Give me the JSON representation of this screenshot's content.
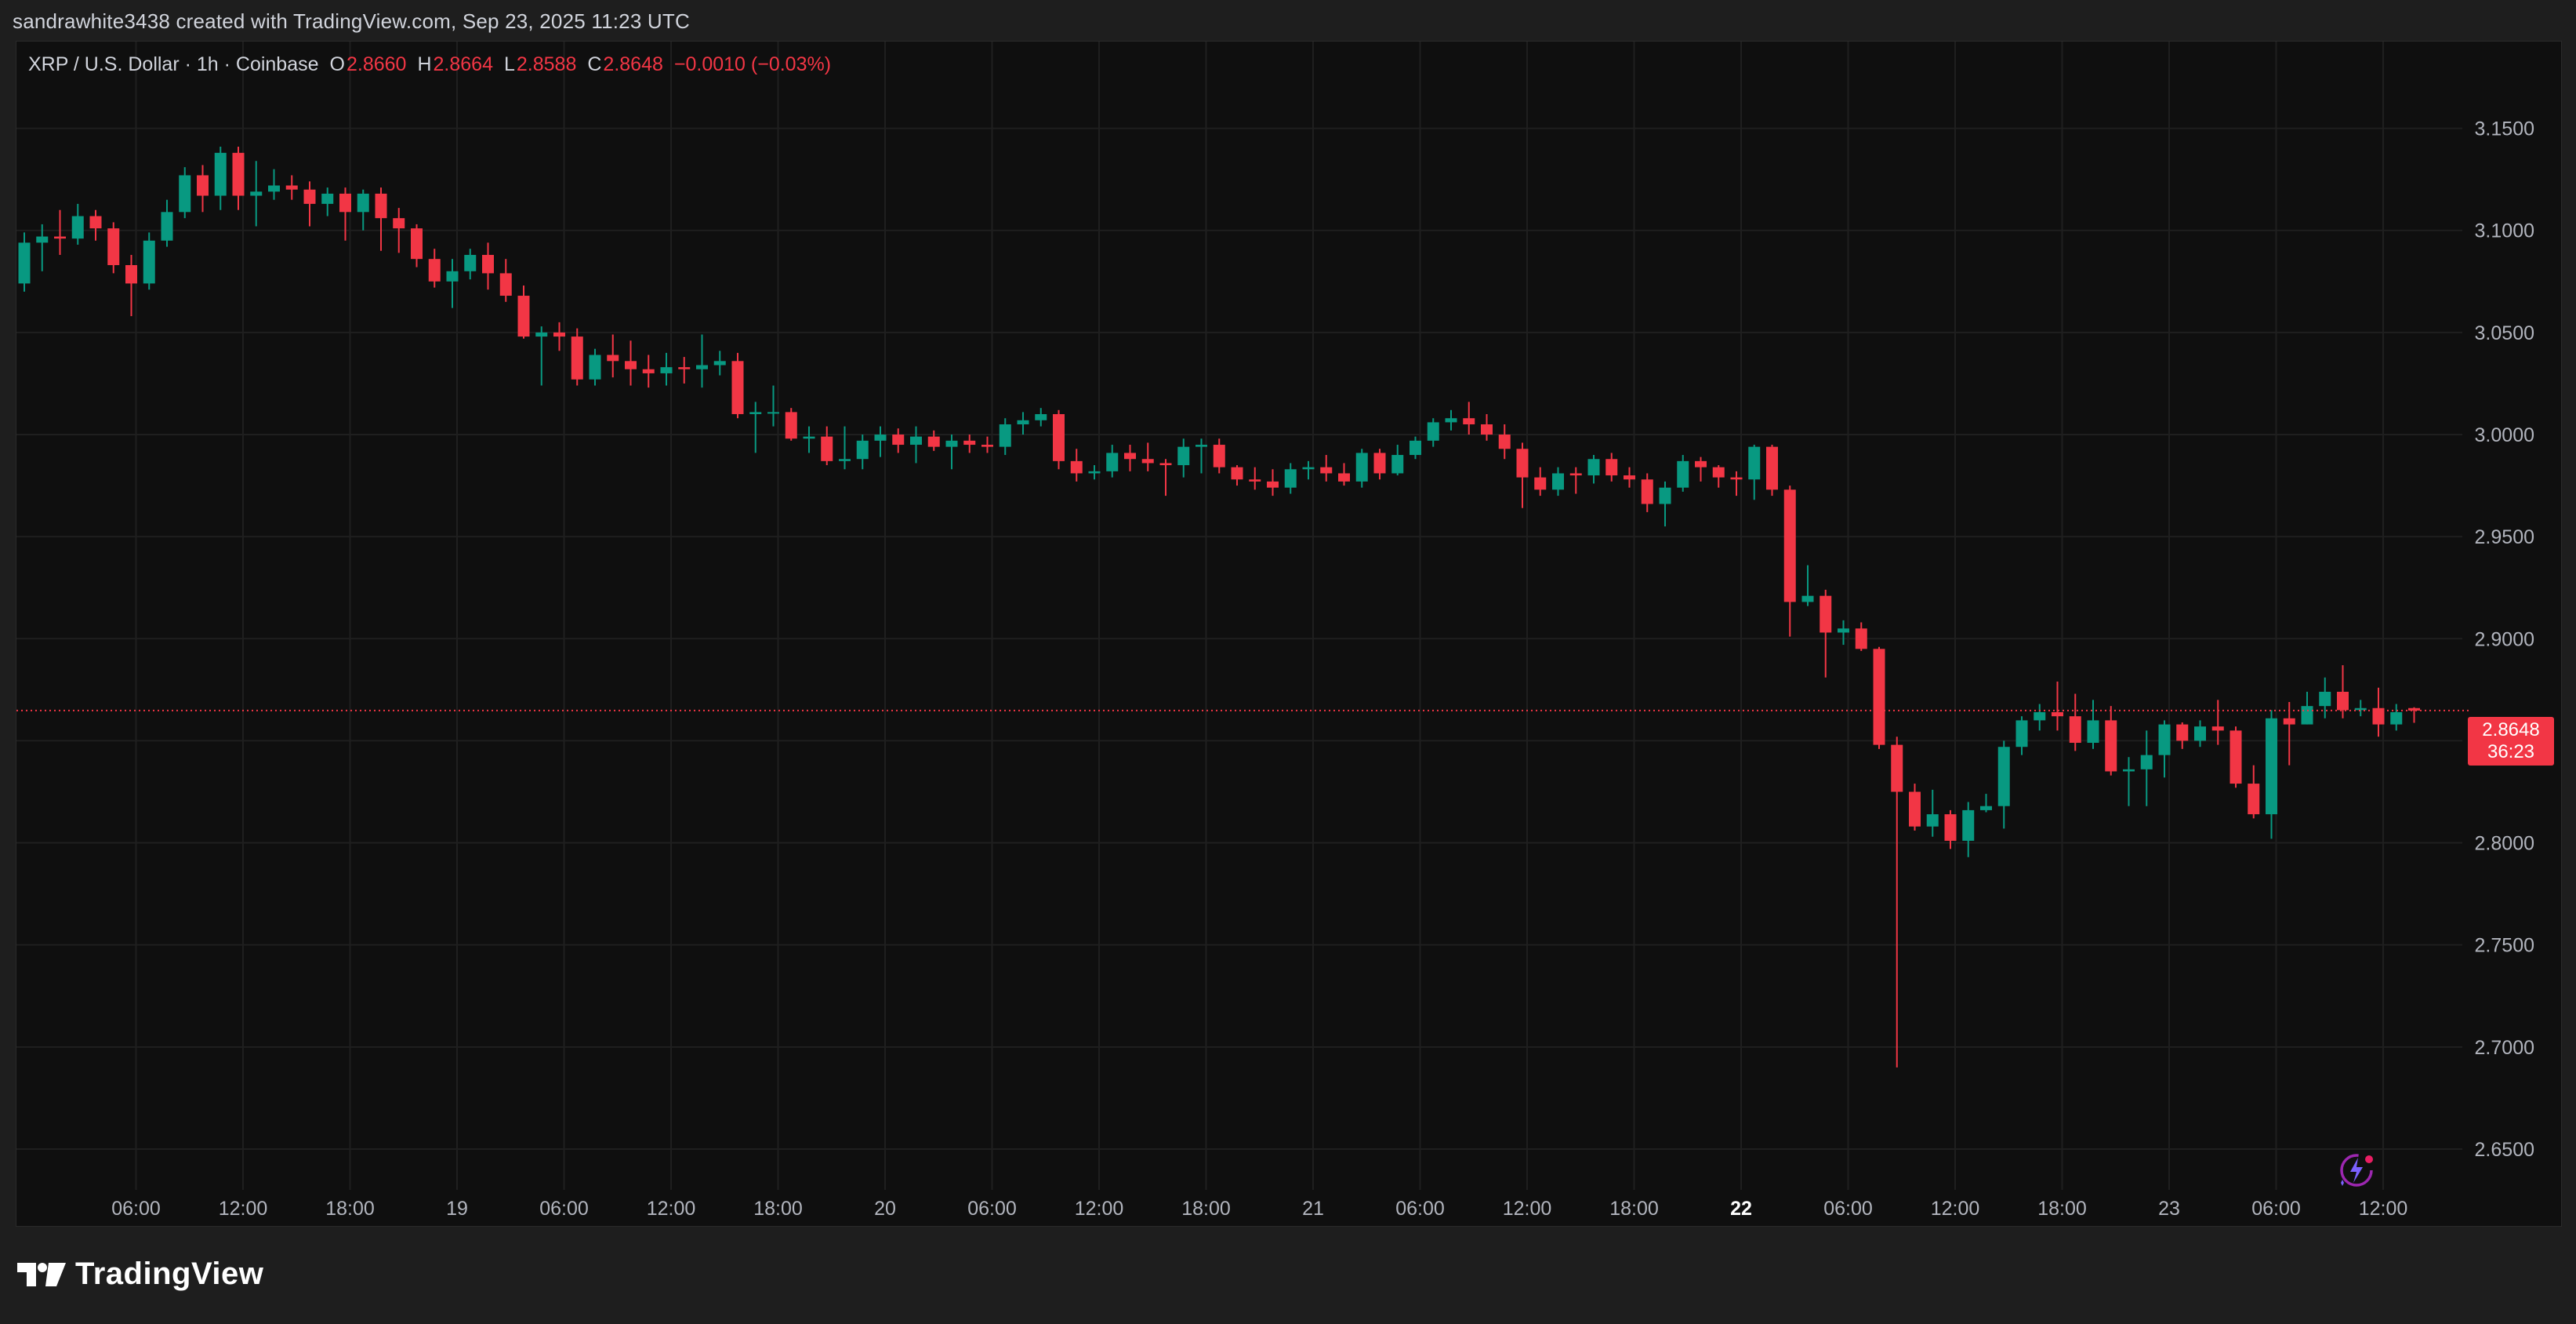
{
  "header": {
    "attribution": "sandrawhite3438 created with TradingView.com, Sep 23, 2025 11:23 UTC"
  },
  "legend": {
    "symbol": "XRP / U.S. Dollar · 1h · Coinbase",
    "open_label": "O",
    "open": "2.8660",
    "high_label": "H",
    "high": "2.8664",
    "low_label": "L",
    "low": "2.8588",
    "close_label": "C",
    "close": "2.8648",
    "change": "−0.0010 (−0.03%)"
  },
  "price_tag": {
    "price": "2.8648",
    "countdown": "36:23"
  },
  "brand": {
    "name": "TradingView"
  },
  "colors": {
    "up": "#089981",
    "down": "#f23645",
    "grid": "#1f1f1f",
    "background": "#0f0f0f",
    "axis_text": "#b2b5be",
    "last_price_line": "#f23645"
  },
  "icons": {
    "logo": "tradingview-logo-icon",
    "bolt": "lightning-bolt-icon"
  },
  "chart_data": {
    "type": "candlestick",
    "interval": "1h",
    "ylim": [
      2.63,
      3.1925
    ],
    "y_ticks": [
      "3.1500",
      "3.1000",
      "3.0500",
      "3.0000",
      "2.9500",
      "2.9000",
      "2.8500",
      "2.8000",
      "2.7500",
      "2.7000",
      "2.6500"
    ],
    "x_ticks": [
      "06:00",
      "12:00",
      "18:00",
      "19",
      "06:00",
      "12:00",
      "18:00",
      "20",
      "06:00",
      "12:00",
      "18:00",
      "21",
      "06:00",
      "12:00",
      "18:00",
      "22",
      "06:00",
      "12:00",
      "18:00",
      "23",
      "06:00",
      "12:00"
    ],
    "bold_x_tick": "22",
    "last_price": 2.8648,
    "candles": [
      [
        3.074,
        3.094,
        3.099,
        3.07
      ],
      [
        3.094,
        3.097,
        3.103,
        3.08
      ],
      [
        3.097,
        3.096,
        3.11,
        3.088
      ],
      [
        3.096,
        3.107,
        3.113,
        3.093
      ],
      [
        3.107,
        3.101,
        3.11,
        3.095
      ],
      [
        3.101,
        3.083,
        3.104,
        3.079
      ],
      [
        3.083,
        3.074,
        3.088,
        3.058
      ],
      [
        3.074,
        3.095,
        3.099,
        3.071
      ],
      [
        3.095,
        3.109,
        3.115,
        3.092
      ],
      [
        3.109,
        3.127,
        3.131,
        3.106
      ],
      [
        3.127,
        3.117,
        3.132,
        3.109
      ],
      [
        3.117,
        3.138,
        3.141,
        3.11
      ],
      [
        3.138,
        3.117,
        3.141,
        3.11
      ],
      [
        3.117,
        3.119,
        3.134,
        3.102
      ],
      [
        3.119,
        3.122,
        3.13,
        3.115
      ],
      [
        3.122,
        3.12,
        3.127,
        3.115
      ],
      [
        3.12,
        3.113,
        3.124,
        3.102
      ],
      [
        3.113,
        3.118,
        3.121,
        3.107
      ],
      [
        3.118,
        3.109,
        3.121,
        3.095
      ],
      [
        3.109,
        3.118,
        3.12,
        3.1
      ],
      [
        3.118,
        3.106,
        3.121,
        3.09
      ],
      [
        3.106,
        3.101,
        3.111,
        3.089
      ],
      [
        3.101,
        3.086,
        3.103,
        3.082
      ],
      [
        3.086,
        3.075,
        3.091,
        3.072
      ],
      [
        3.075,
        3.08,
        3.086,
        3.062
      ],
      [
        3.08,
        3.088,
        3.091,
        3.076
      ],
      [
        3.088,
        3.079,
        3.094,
        3.071
      ],
      [
        3.079,
        3.068,
        3.086,
        3.065
      ],
      [
        3.068,
        3.048,
        3.073,
        3.047
      ],
      [
        3.048,
        3.05,
        3.053,
        3.024
      ],
      [
        3.05,
        3.048,
        3.055,
        3.041
      ],
      [
        3.048,
        3.027,
        3.052,
        3.024
      ],
      [
        3.027,
        3.039,
        3.042,
        3.024
      ],
      [
        3.039,
        3.036,
        3.049,
        3.028
      ],
      [
        3.036,
        3.032,
        3.046,
        3.024
      ],
      [
        3.032,
        3.03,
        3.039,
        3.023
      ],
      [
        3.03,
        3.033,
        3.04,
        3.024
      ],
      [
        3.033,
        3.032,
        3.038,
        3.025
      ],
      [
        3.032,
        3.034,
        3.049,
        3.023
      ],
      [
        3.034,
        3.036,
        3.041,
        3.029
      ],
      [
        3.036,
        3.01,
        3.04,
        3.008
      ],
      [
        3.01,
        3.011,
        3.016,
        2.991
      ],
      [
        3.011,
        3.011,
        3.024,
        3.004
      ],
      [
        3.011,
        2.998,
        3.013,
        2.997
      ],
      [
        2.998,
        2.999,
        3.004,
        2.991
      ],
      [
        2.999,
        2.987,
        3.004,
        2.985
      ],
      [
        2.987,
        2.988,
        3.004,
        2.983
      ],
      [
        2.988,
        2.997,
        3.0,
        2.983
      ],
      [
        2.997,
        3.0,
        3.004,
        2.989
      ],
      [
        3.0,
        2.995,
        3.003,
        2.991
      ],
      [
        2.995,
        2.999,
        3.004,
        2.986
      ],
      [
        2.999,
        2.994,
        3.002,
        2.992
      ],
      [
        2.994,
        2.997,
        3.0,
        2.983
      ],
      [
        2.997,
        2.995,
        3.0,
        2.991
      ],
      [
        2.995,
        2.994,
        2.999,
        2.991
      ],
      [
        2.994,
        3.005,
        3.008,
        2.99
      ],
      [
        3.005,
        3.007,
        3.011,
        3.0
      ],
      [
        3.007,
        3.01,
        3.013,
        3.004
      ],
      [
        3.01,
        2.987,
        3.012,
        2.983
      ],
      [
        2.987,
        2.981,
        2.993,
        2.977
      ],
      [
        2.981,
        2.982,
        2.985,
        2.978
      ],
      [
        2.982,
        2.991,
        2.995,
        2.979
      ],
      [
        2.991,
        2.988,
        2.995,
        2.982
      ],
      [
        2.988,
        2.986,
        2.996,
        2.982
      ],
      [
        2.986,
        2.985,
        2.988,
        2.97
      ],
      [
        2.985,
        2.994,
        2.998,
        2.979
      ],
      [
        2.994,
        2.995,
        2.998,
        2.981
      ],
      [
        2.995,
        2.984,
        2.998,
        2.981
      ],
      [
        2.984,
        2.978,
        2.985,
        2.975
      ],
      [
        2.978,
        2.977,
        2.984,
        2.973
      ],
      [
        2.977,
        2.974,
        2.983,
        2.97
      ],
      [
        2.974,
        2.983,
        2.986,
        2.971
      ],
      [
        2.983,
        2.984,
        2.987,
        2.978
      ],
      [
        2.984,
        2.981,
        2.99,
        2.977
      ],
      [
        2.981,
        2.977,
        2.986,
        2.975
      ],
      [
        2.977,
        2.991,
        2.993,
        2.974
      ],
      [
        2.991,
        2.981,
        2.993,
        2.978
      ],
      [
        2.981,
        2.99,
        2.995,
        2.98
      ],
      [
        2.99,
        2.997,
        2.999,
        2.988
      ],
      [
        2.997,
        3.006,
        3.008,
        2.994
      ],
      [
        3.006,
        3.008,
        3.012,
        3.002
      ],
      [
        3.008,
        3.005,
        3.016,
        3.0
      ],
      [
        3.005,
        3.0,
        3.01,
        2.997
      ],
      [
        3.0,
        2.993,
        3.005,
        2.988
      ],
      [
        2.993,
        2.979,
        2.996,
        2.964
      ],
      [
        2.979,
        2.973,
        2.984,
        2.97
      ],
      [
        2.973,
        2.981,
        2.984,
        2.97
      ],
      [
        2.981,
        2.98,
        2.984,
        2.971
      ],
      [
        2.98,
        2.988,
        2.99,
        2.976
      ],
      [
        2.988,
        2.98,
        2.991,
        2.977
      ],
      [
        2.98,
        2.978,
        2.984,
        2.974
      ],
      [
        2.978,
        2.966,
        2.981,
        2.962
      ],
      [
        2.966,
        2.974,
        2.977,
        2.955
      ],
      [
        2.974,
        2.987,
        2.99,
        2.972
      ],
      [
        2.987,
        2.984,
        2.989,
        2.977
      ],
      [
        2.984,
        2.979,
        2.985,
        2.974
      ],
      [
        2.979,
        2.978,
        2.982,
        2.97
      ],
      [
        2.978,
        2.994,
        2.995,
        2.968
      ],
      [
        2.994,
        2.973,
        2.995,
        2.97
      ],
      [
        2.973,
        2.918,
        2.975,
        2.901
      ],
      [
        2.918,
        2.921,
        2.936,
        2.916
      ],
      [
        2.921,
        2.903,
        2.924,
        2.881
      ],
      [
        2.903,
        2.905,
        2.909,
        2.897
      ],
      [
        2.905,
        2.895,
        2.908,
        2.894
      ],
      [
        2.895,
        2.848,
        2.896,
        2.846
      ],
      [
        2.848,
        2.825,
        2.852,
        2.69
      ],
      [
        2.825,
        2.808,
        2.829,
        2.806
      ],
      [
        2.808,
        2.814,
        2.826,
        2.803
      ],
      [
        2.814,
        2.801,
        2.816,
        2.797
      ],
      [
        2.801,
        2.816,
        2.82,
        2.793
      ],
      [
        2.816,
        2.818,
        2.824,
        2.815
      ],
      [
        2.818,
        2.847,
        2.85,
        2.807
      ],
      [
        2.847,
        2.86,
        2.862,
        2.843
      ],
      [
        2.86,
        2.864,
        2.868,
        2.855
      ],
      [
        2.864,
        2.862,
        2.879,
        2.855
      ],
      [
        2.862,
        2.849,
        2.873,
        2.845
      ],
      [
        2.849,
        2.86,
        2.87,
        2.846
      ],
      [
        2.86,
        2.835,
        2.867,
        2.833
      ],
      [
        2.835,
        2.836,
        2.842,
        2.818
      ],
      [
        2.836,
        2.843,
        2.855,
        2.818
      ],
      [
        2.843,
        2.858,
        2.86,
        2.832
      ],
      [
        2.858,
        2.85,
        2.859,
        2.846
      ],
      [
        2.85,
        2.857,
        2.86,
        2.847
      ],
      [
        2.857,
        2.855,
        2.87,
        2.848
      ],
      [
        2.855,
        2.829,
        2.857,
        2.827
      ],
      [
        2.829,
        2.814,
        2.838,
        2.812
      ],
      [
        2.814,
        2.861,
        2.865,
        2.802
      ],
      [
        2.861,
        2.858,
        2.869,
        2.838
      ],
      [
        2.858,
        2.867,
        2.874,
        2.858
      ],
      [
        2.867,
        2.874,
        2.881,
        2.861
      ],
      [
        2.874,
        2.865,
        2.887,
        2.861
      ],
      [
        2.865,
        2.866,
        2.87,
        2.862
      ],
      [
        2.866,
        2.858,
        2.876,
        2.852
      ],
      [
        2.858,
        2.864,
        2.868,
        2.855
      ],
      [
        2.866,
        2.8648,
        2.8664,
        2.8588
      ]
    ]
  }
}
